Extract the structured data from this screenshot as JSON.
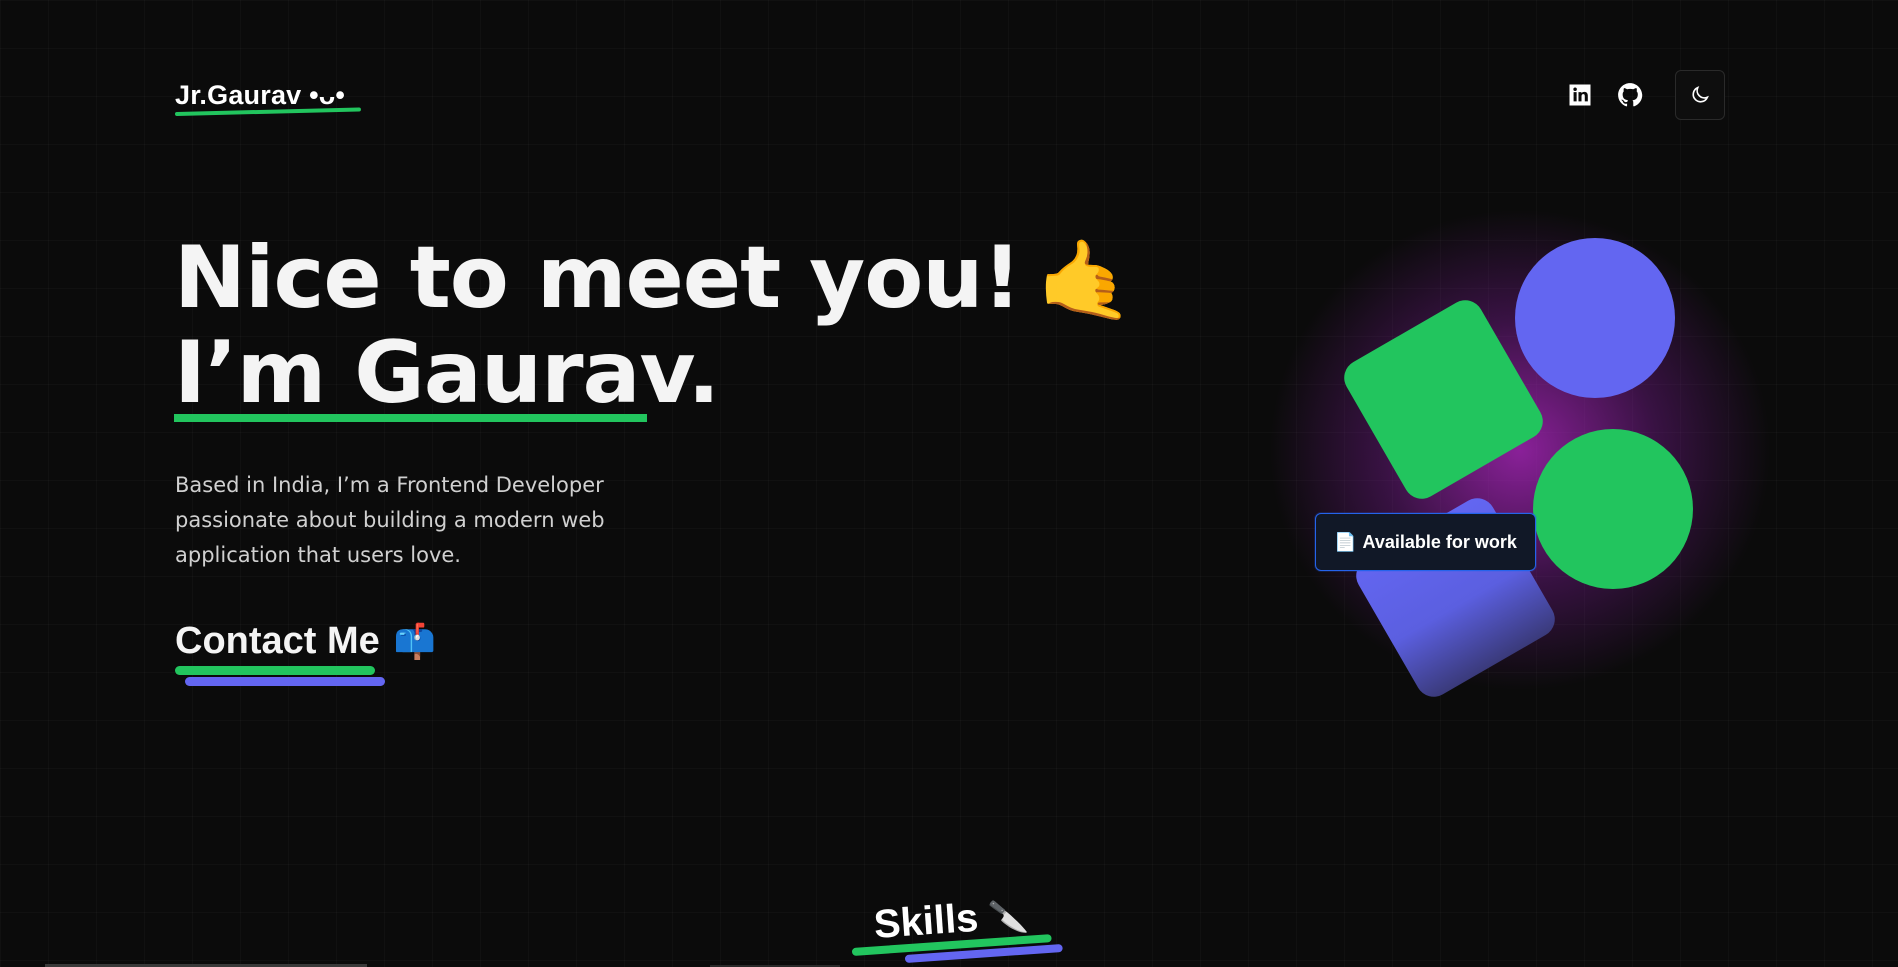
{
  "nav": {
    "logo": "Jr.Gaurav •ᴗ•",
    "links": [
      {
        "icon": "linkedin-icon"
      },
      {
        "icon": "github-icon"
      }
    ],
    "theme_toggle_icon": "moon-icon"
  },
  "hero": {
    "title_line1": "Nice to meet you!",
    "title_emoji": "🤙",
    "title_line2": "I’m Gaurav.",
    "bio": "Based in India, I’m a Frontend Developer passionate about building a modern web application that users love.",
    "cta_label": "Contact Me",
    "cta_emoji": "📫"
  },
  "badge": {
    "icon": "📄",
    "label": "Available for work"
  },
  "skills_section": {
    "title": "Skills",
    "emoji": "🔪"
  },
  "colors": {
    "background": "#0b0b0b",
    "accent_green": "#22c55e",
    "accent_indigo": "#6366f1",
    "glow": "#b428c8"
  }
}
